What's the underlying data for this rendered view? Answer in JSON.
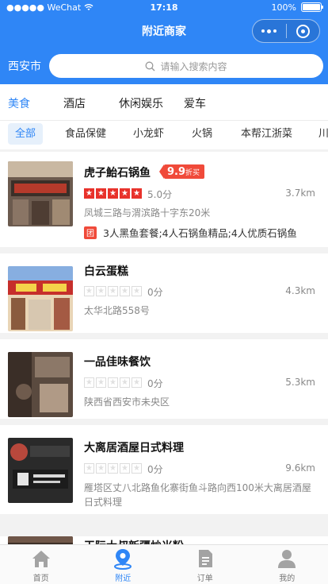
{
  "status_bar": {
    "carrier": "●●●●● WeChat",
    "time": "17:18",
    "battery": "100%"
  },
  "nav": {
    "title": "附近商家"
  },
  "search": {
    "city": "西安市",
    "placeholder": "请输入搜索内容"
  },
  "categories": [
    "美食",
    "酒店",
    "休闲娱乐",
    "爱车"
  ],
  "chips": [
    "全部",
    "食品保健",
    "小龙虾",
    "火锅",
    "本帮江浙菜",
    "川"
  ],
  "merchants": [
    {
      "name": "虎子鮐石锅鱼",
      "discount_value": "9.9",
      "discount_unit": "折买",
      "rating": 5,
      "score": "5.0分",
      "distance": "3.7km",
      "address": "凤城三路与渭滨路十字东20米",
      "deal_tag": "团",
      "deal_text": "3人黑鱼套餐;4人石锅鱼精品;4人优质石锅鱼"
    },
    {
      "name": "白云蛋糕",
      "rating": 0,
      "score": "0分",
      "distance": "4.3km",
      "address": "太华北路558号"
    },
    {
      "name": "一品佳味餐饮",
      "rating": 0,
      "score": "0分",
      "distance": "5.3km",
      "address": "陕西省西安市未央区"
    },
    {
      "name": "大离居酒屋日式料理",
      "rating": 0,
      "score": "0分",
      "distance": "9.6km",
      "address": "雁塔区丈八北路鱼化寨街鱼斗路向西100米大离居酒屋日式料理"
    },
    {
      "name": "天际大叔新疆炒米粉"
    }
  ],
  "tabs": [
    "首页",
    "附近",
    "订单",
    "我的"
  ],
  "colors": {
    "brand_blue": "#2f86f6",
    "discount_red": "#f04a3a",
    "star_red": "#e8322b"
  }
}
